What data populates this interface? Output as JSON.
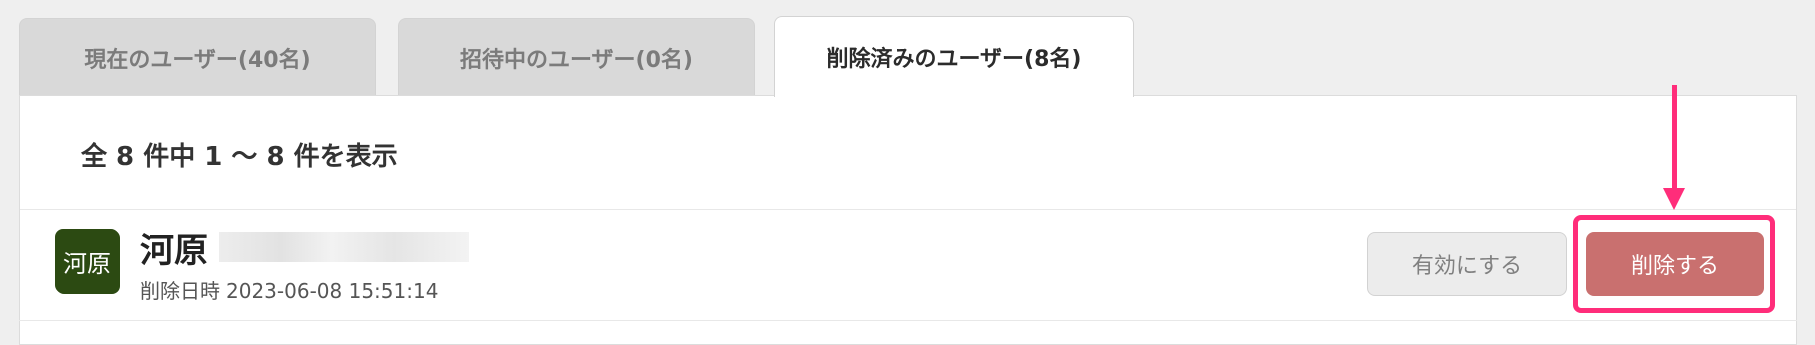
{
  "tabs": [
    {
      "label": "現在のユーザー(40名)",
      "active": false
    },
    {
      "label": "招待中のユーザー(0名)",
      "active": false
    },
    {
      "label": "削除済みのユーザー(8名)",
      "active": true
    }
  ],
  "summary": "全 8 件中 1 〜 8 件を表示",
  "user": {
    "avatar_text": "河原",
    "avatar_color": "#2c4a12",
    "name": "河原",
    "deleted_label": "削除日時",
    "deleted_at": "2023-06-08 15:51:14"
  },
  "actions": {
    "enable_label": "有効にする",
    "delete_label": "削除する"
  },
  "annotation": {
    "highlight_color": "#ff2d7a"
  }
}
